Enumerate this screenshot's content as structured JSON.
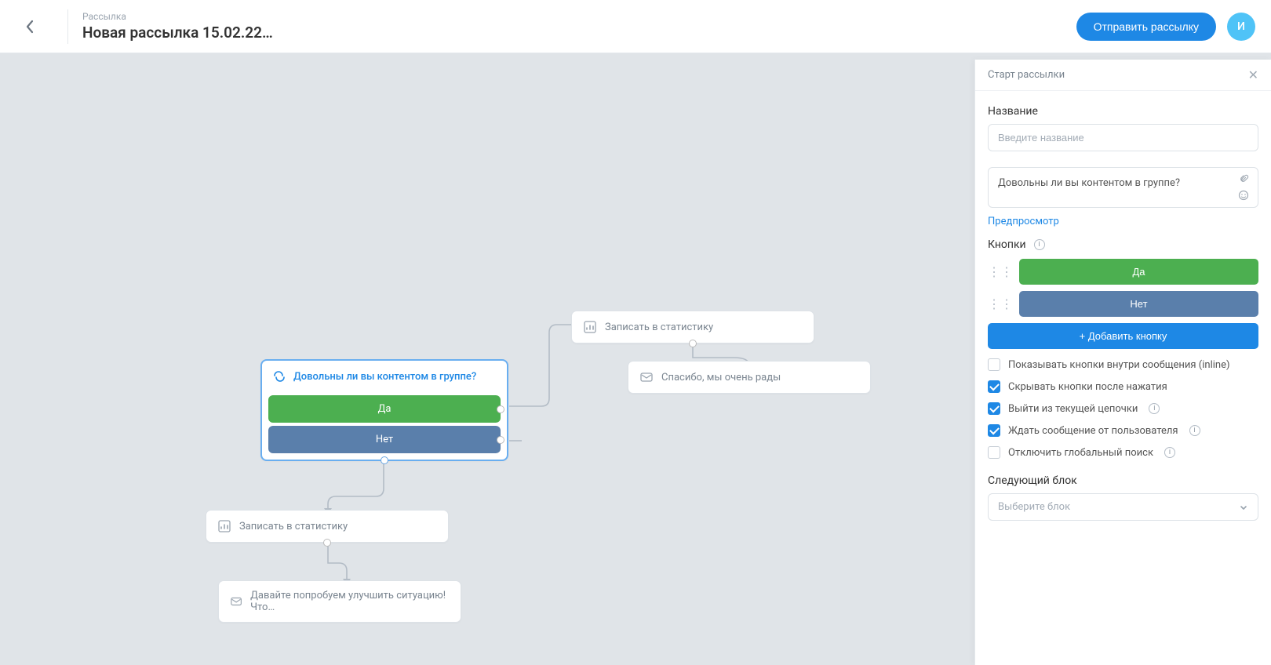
{
  "header": {
    "subtitle": "Рассылка",
    "title": "Новая рассылка 15.02.22…",
    "send_label": "Отправить рассылку",
    "avatar_initial": "И"
  },
  "canvas": {
    "start_node": {
      "question": "Довольны ли вы контентом в группе?",
      "yes": "Да",
      "no": "Нет"
    },
    "stat_top": {
      "label": "Записать в статистику"
    },
    "stat_bottom": {
      "label": "Записать в статистику"
    },
    "thanks_node": {
      "label": "Спасибо, мы очень рады"
    },
    "improve_node": {
      "label": "Давайте попробуем улучшить ситуацию! Что…"
    }
  },
  "panel": {
    "title": "Старт рассылки",
    "name_label": "Название",
    "name_placeholder": "Введите название",
    "message_text": "Довольны ли вы контентом в группе?",
    "preview_link": "Предпросмотр",
    "buttons_label": "Кнопки",
    "button_yes": "Да",
    "button_no": "Нет",
    "add_button": "+ Добавить кнопку",
    "opt_inline": "Показывать кнопки внутри сообщения (inline)",
    "opt_hide_after": "Скрывать кнопки после нажатия",
    "opt_exit_chain": "Выйти из текущей цепочки",
    "opt_wait_msg": "Ждать сообщение от пользователя",
    "opt_global_search": "Отключить глобальный поиск",
    "next_block_label": "Следующий блок",
    "next_block_placeholder": "Выберите блок"
  }
}
